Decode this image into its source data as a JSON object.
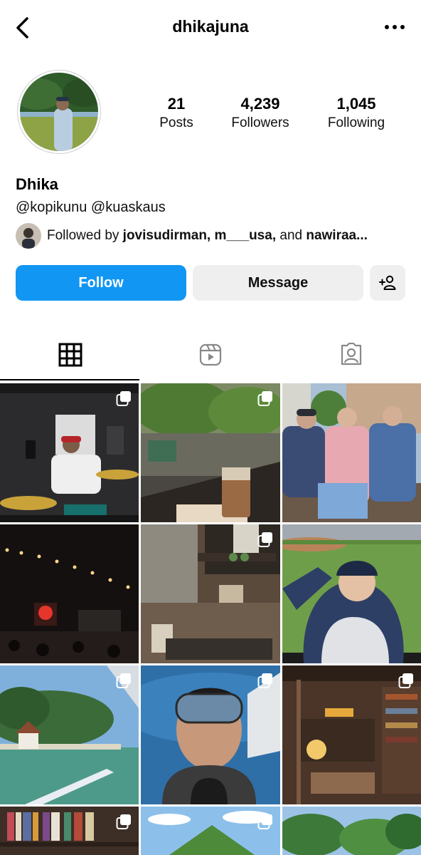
{
  "header": {
    "username": "dhikajuna"
  },
  "profile": {
    "name": "Dhika",
    "handles": "@kopikunu @kuaskaus",
    "stats": [
      {
        "value": "21",
        "label": "Posts"
      },
      {
        "value": "4,239",
        "label": "Followers"
      },
      {
        "value": "1,045",
        "label": "Following"
      }
    ],
    "followed_by": {
      "prefix": "Followed by ",
      "names": "jovisudirman, m___usa,",
      "joiner": " and ",
      "last": "nawiraa..."
    }
  },
  "actions": {
    "follow": "Follow",
    "message": "Message"
  },
  "tabs": [
    {
      "name": "grid-icon",
      "active": true
    },
    {
      "name": "reels-icon",
      "active": false
    },
    {
      "name": "tagged-icon",
      "active": false
    }
  ],
  "icons": {
    "back": "back-chevron-icon",
    "more": "more-options-icon",
    "add_person": "add-person-icon",
    "multi_post": "multi-post-icon"
  },
  "colors": {
    "accent": "#1196f4",
    "secondary_button": "#efefef"
  }
}
